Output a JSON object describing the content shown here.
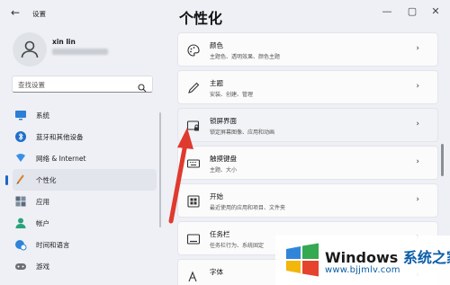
{
  "window": {
    "title": "设置",
    "back": "←",
    "minimize": "—",
    "maximize": "▢",
    "close": "✕"
  },
  "page_title": "个性化",
  "user": {
    "name": "xin lin"
  },
  "search": {
    "placeholder": "查找设置"
  },
  "nav": [
    {
      "label": "系统",
      "icon": "monitor-icon"
    },
    {
      "label": "蓝牙和其他设备",
      "icon": "bluetooth-icon"
    },
    {
      "label": "网络 & Internet",
      "icon": "wifi-icon"
    },
    {
      "label": "个性化",
      "icon": "brush-icon",
      "active": true
    },
    {
      "label": "应用",
      "icon": "apps-icon"
    },
    {
      "label": "帐户",
      "icon": "person-icon"
    },
    {
      "label": "时间和语言",
      "icon": "globe-clock-icon"
    },
    {
      "label": "游戏",
      "icon": "gamepad-icon"
    }
  ],
  "cards": [
    {
      "title": "颜色",
      "sub": "主题色、透明效果、颜色主题",
      "icon": "palette-icon"
    },
    {
      "title": "主题",
      "sub": "安装、创建、管理",
      "icon": "pen-icon"
    },
    {
      "title": "锁屏界面",
      "sub": "锁定屏幕图像、应用和动画",
      "icon": "lockscreen-icon"
    },
    {
      "title": "触摸键盘",
      "sub": "主题、大小",
      "icon": "keyboard-icon"
    },
    {
      "title": "开始",
      "sub": "最近使用的应用和项目、文件夹",
      "icon": "start-icon"
    },
    {
      "title": "任务栏",
      "sub": "任务栏行为、系统固定",
      "icon": "taskbar-icon"
    },
    {
      "title": "字体",
      "sub": "",
      "icon": "font-icon"
    }
  ],
  "chevron": "›",
  "watermark": {
    "brand": "Windows",
    "suffix": "系统之家",
    "url": "www.bjjmlv.com"
  },
  "colors": {
    "accent": "#1a66c8",
    "arrow": "#e03a2f"
  }
}
